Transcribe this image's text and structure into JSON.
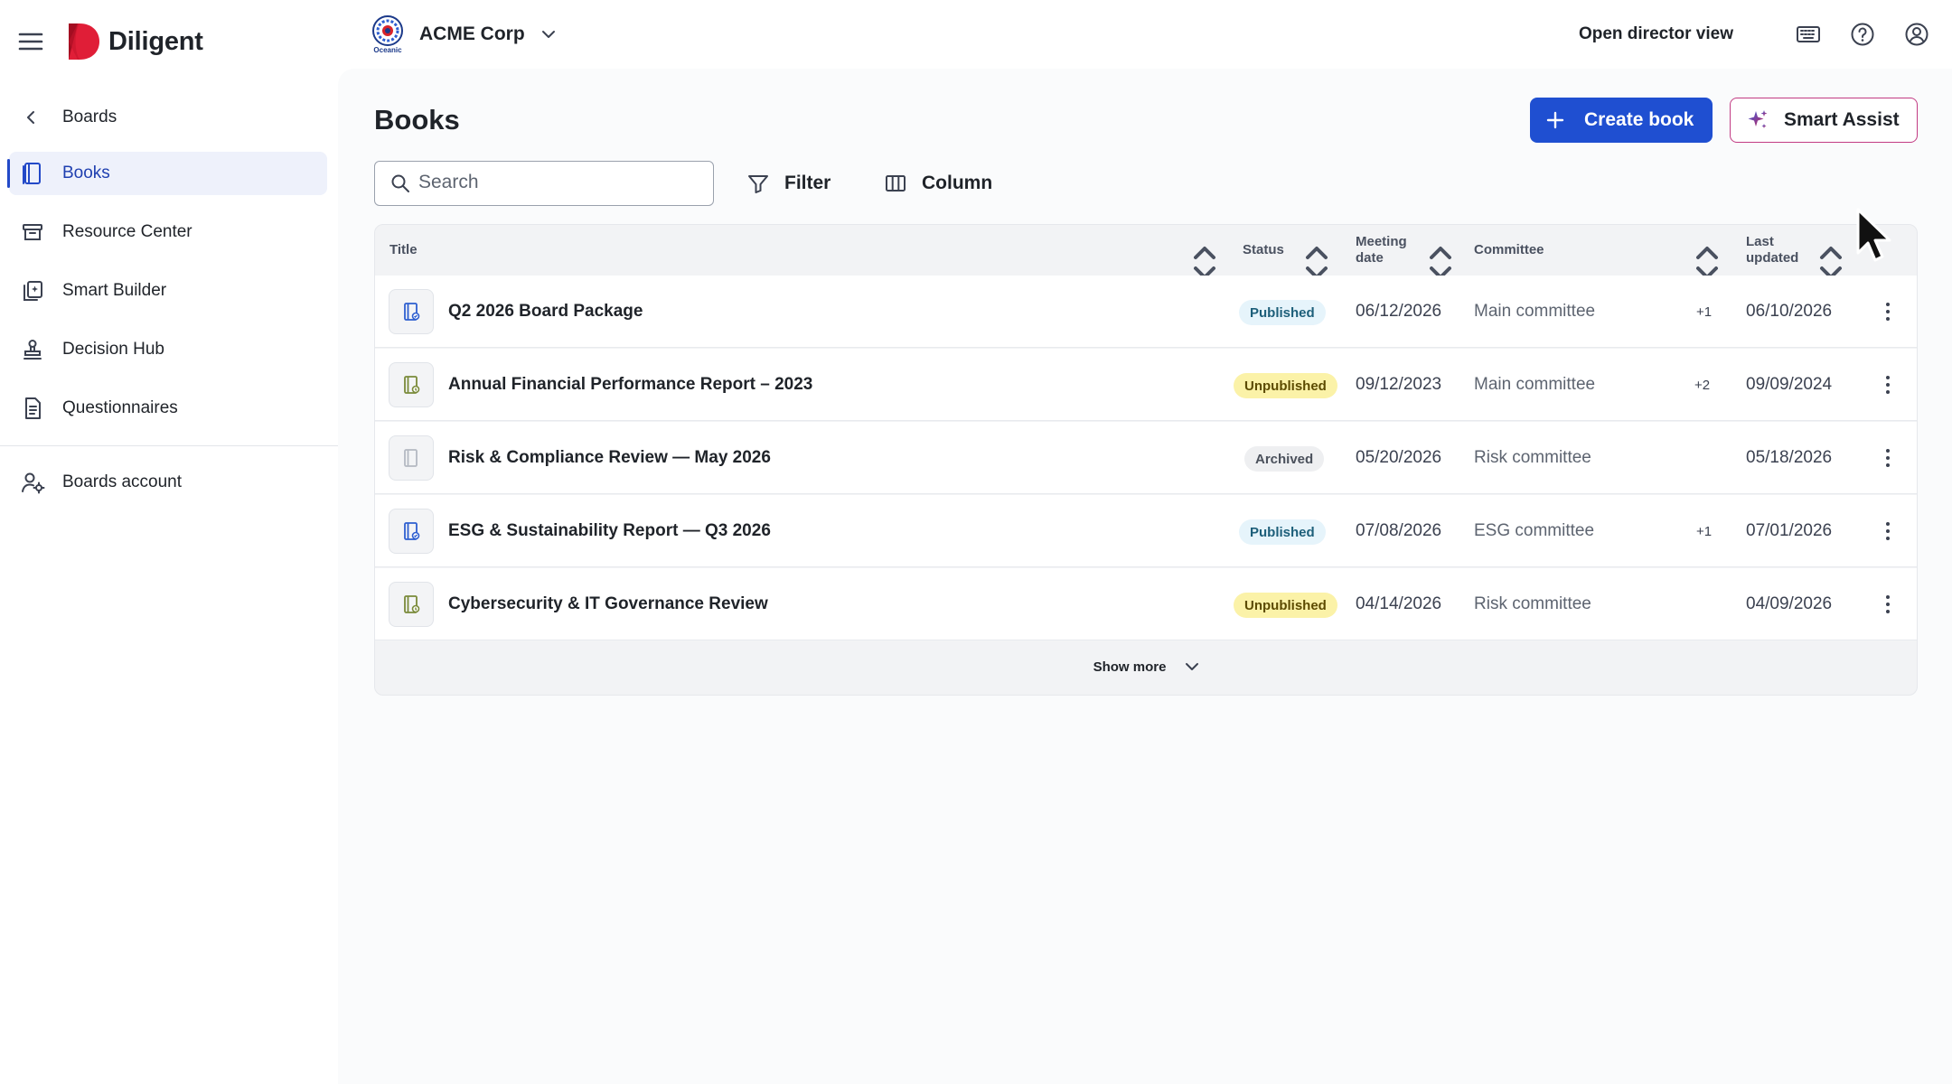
{
  "app": {
    "brand": "Diligent",
    "brand_color": "#d3122a"
  },
  "org": {
    "name": "ACME Corp",
    "logo_text": "Oceanic"
  },
  "topbar": {
    "director_view": "Open director view"
  },
  "sidebar": {
    "back_label": "Boards",
    "items": [
      {
        "label": "Books",
        "icon": "book-icon",
        "active": true
      },
      {
        "label": "Resource Center",
        "icon": "archive-icon"
      },
      {
        "label": "Smart Builder",
        "icon": "smart-builder-icon"
      },
      {
        "label": "Decision Hub",
        "icon": "stamp-icon"
      },
      {
        "label": "Questionnaires",
        "icon": "questionnaire-icon"
      }
    ],
    "account_label": "Boards account"
  },
  "page": {
    "title": "Books"
  },
  "actions": {
    "create_label": "Create book",
    "assist_label": "Smart Assist"
  },
  "toolbar": {
    "search_placeholder": "Search",
    "filter_label": "Filter",
    "column_label": "Column"
  },
  "table": {
    "columns": {
      "title": "Title",
      "status": "Status",
      "meeting_date_1": "Meeting",
      "meeting_date_2": "date",
      "committee": "Committee",
      "last_updated_1": "Last",
      "last_updated_2": "updated"
    },
    "rows": [
      {
        "title": "Q2 2026 Board Package",
        "status": "Published",
        "status_kind": "published",
        "meeting_date": "06/12/2026",
        "committee": "Main committee",
        "extra": "+1",
        "last_updated": "06/10/2026"
      },
      {
        "title": "Annual Financial Performance Report – 2023",
        "status": "Unpublished",
        "status_kind": "unpublished",
        "meeting_date": "09/12/2023",
        "committee": "Main committee",
        "extra": "+2",
        "last_updated": "09/09/2024"
      },
      {
        "title": "Risk & Compliance Review — May 2026",
        "status": "Archived",
        "status_kind": "archived",
        "meeting_date": "05/20/2026",
        "committee": "Risk committee",
        "extra": "",
        "last_updated": "05/18/2026"
      },
      {
        "title": "ESG & Sustainability Report — Q3 2026",
        "status": "Published",
        "status_kind": "published",
        "meeting_date": "07/08/2026",
        "committee": "ESG committee",
        "extra": "+1",
        "last_updated": "07/01/2026"
      },
      {
        "title": "Cybersecurity & IT Governance Review",
        "status": "Unpublished",
        "status_kind": "unpublished",
        "meeting_date": "04/14/2026",
        "committee": "Risk committee",
        "extra": "",
        "last_updated": "04/09/2026"
      }
    ],
    "show_more": "Show more"
  }
}
